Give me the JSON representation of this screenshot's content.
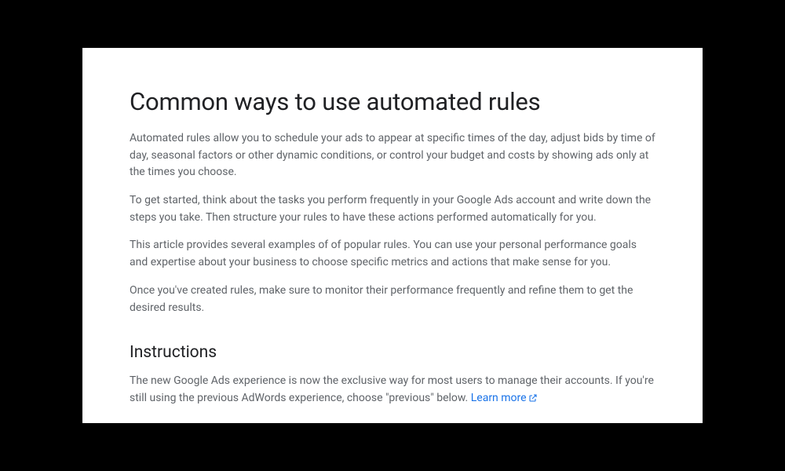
{
  "title": "Common ways to use automated rules",
  "paragraphs": [
    "Automated rules allow you to schedule your ads to appear at specific times of the day, adjust bids by time of day, seasonal factors or other dynamic conditions, or control your budget and costs by showing ads only at the times you choose.",
    " To get started, think about the tasks you perform frequently in your Google Ads account and write down the steps you take. Then structure your rules to have these actions performed automatically for you.",
    "This article provides several examples of of popular rules. You can use your personal performance goals and expertise about your business to choose specific metrics and actions that make sense for you.",
    "Once you've created rules, make sure to monitor their performance frequently and refine them to get the desired results."
  ],
  "instructions": {
    "heading": "Instructions",
    "text": "The new Google Ads experience is now the exclusive way for most users to manage their accounts. If you're still using the previous AdWords experience, choose \"previous\" below. ",
    "link_label": "Learn more"
  }
}
